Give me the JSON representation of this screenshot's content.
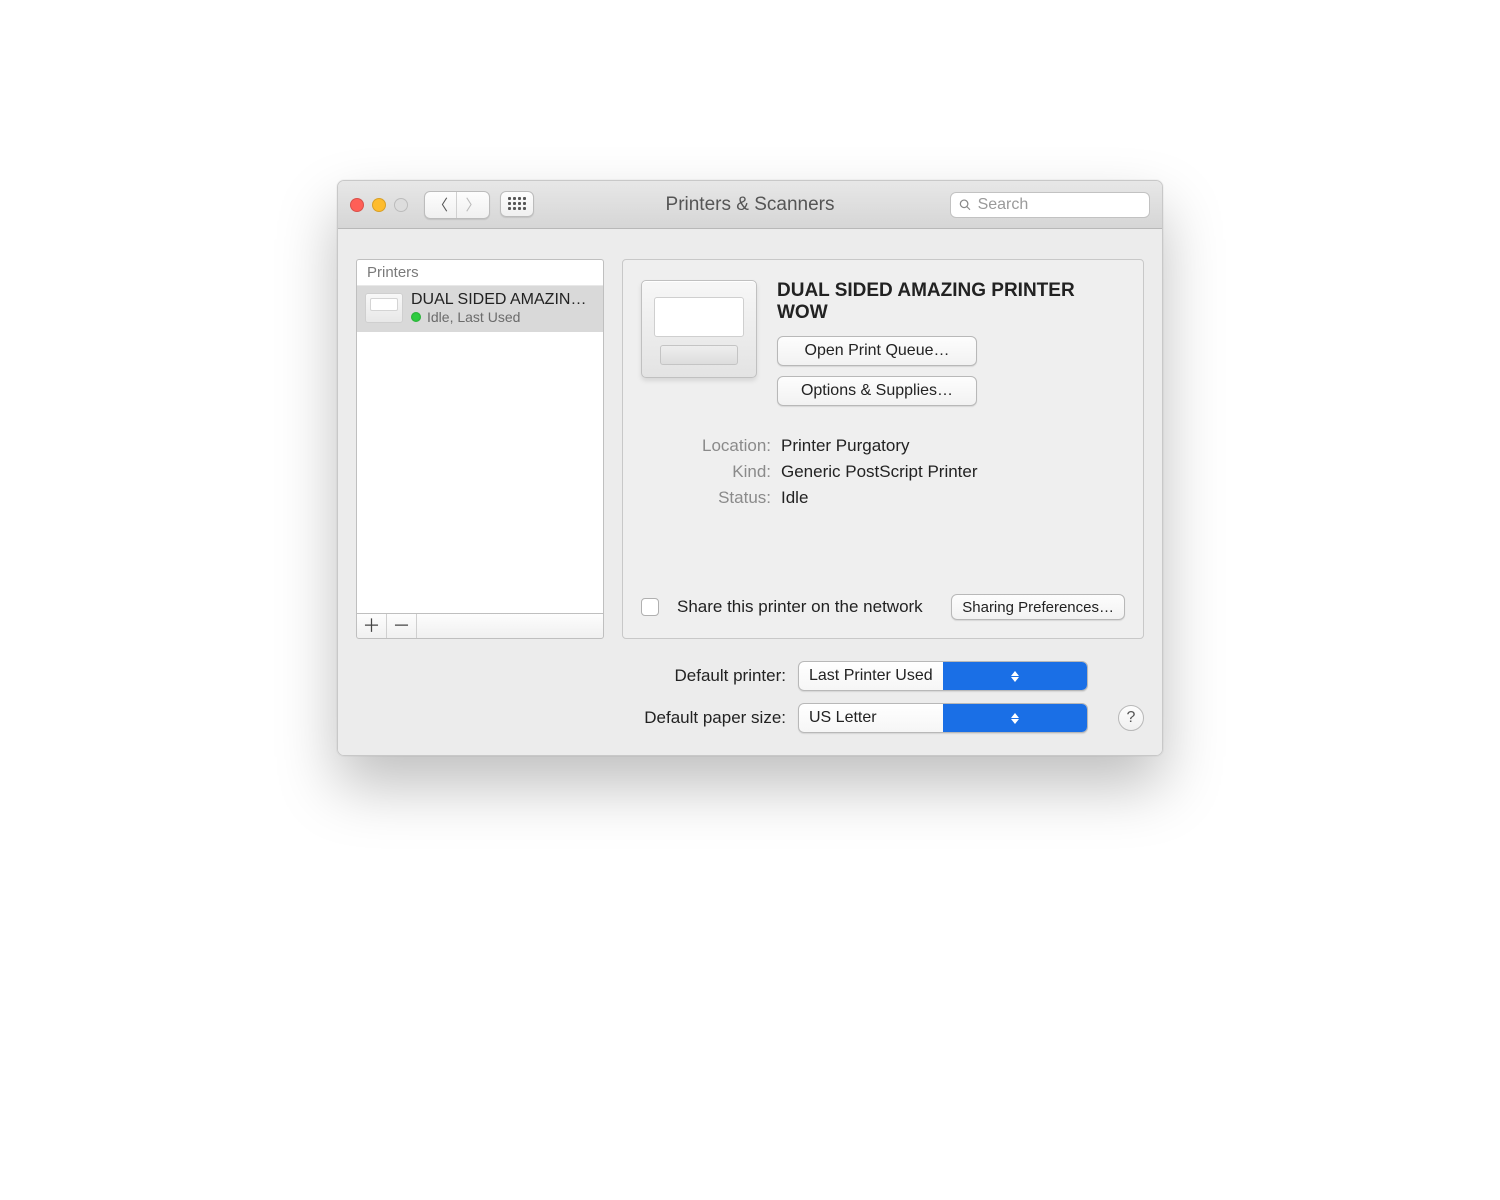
{
  "window": {
    "title": "Printers & Scanners",
    "search_placeholder": "Search"
  },
  "sidebar": {
    "header": "Printers",
    "add_glyph": "＋",
    "remove_glyph": "－",
    "items": [
      {
        "name": "DUAL SIDED AMAZIN…",
        "status": "Idle, Last Used"
      }
    ]
  },
  "detail": {
    "printer_title": "DUAL SIDED AMAZING PRINTER WOW",
    "open_queue_label": "Open Print Queue…",
    "options_supplies_label": "Options & Supplies…",
    "location_label": "Location:",
    "location_value": "Printer Purgatory",
    "kind_label": "Kind:",
    "kind_value": "Generic PostScript Printer",
    "status_label": "Status:",
    "status_value": "Idle",
    "share_label": "Share this printer on the network",
    "sharing_prefs_label": "Sharing Preferences…"
  },
  "defaults": {
    "default_printer_label": "Default printer:",
    "default_printer_value": "Last Printer Used",
    "default_paper_label": "Default paper size:",
    "default_paper_value": "US Letter"
  },
  "help_glyph": "?"
}
